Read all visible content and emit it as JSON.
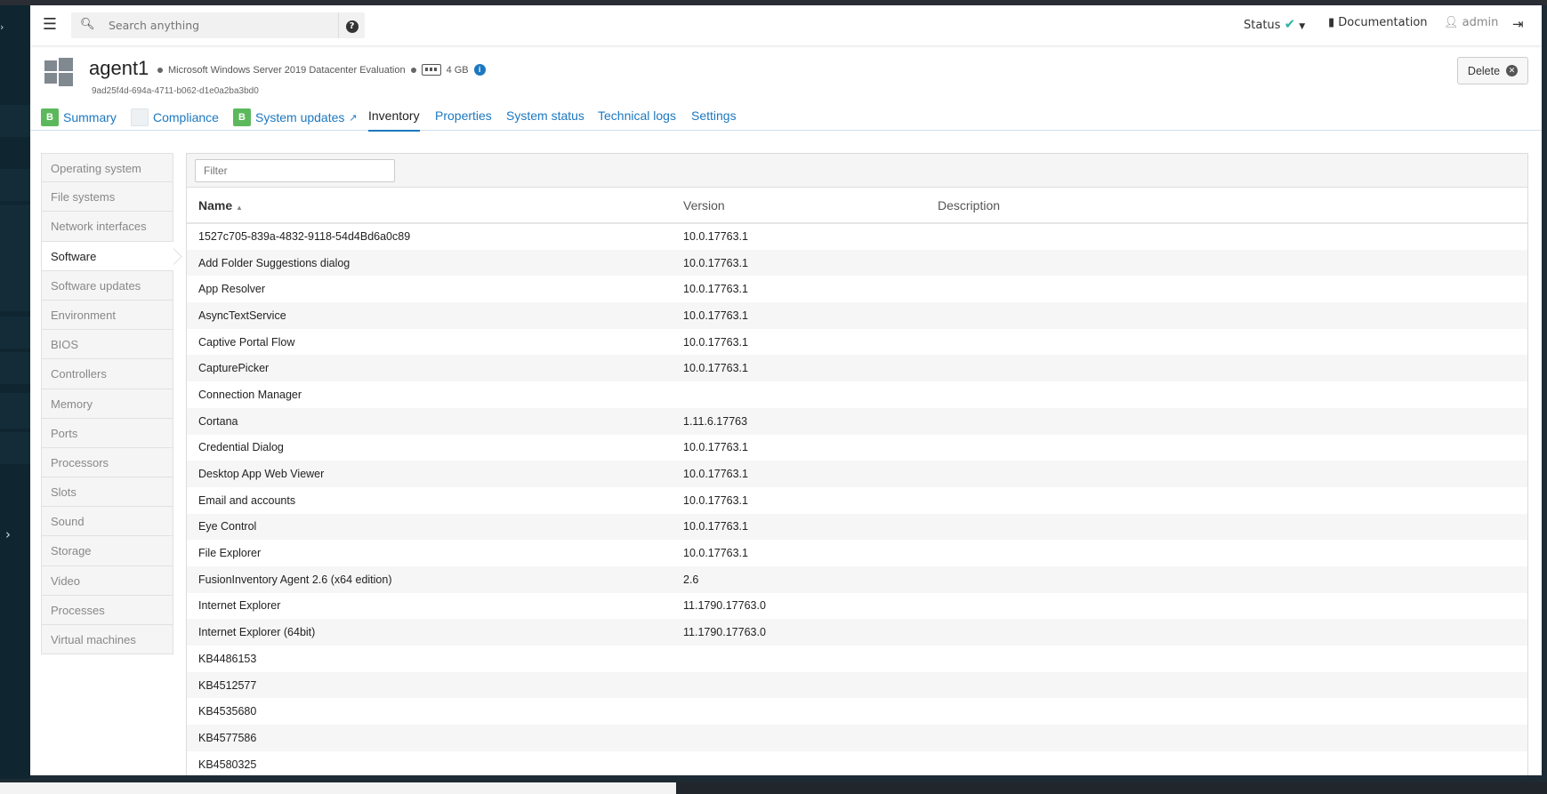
{
  "header": {
    "search_placeholder": "Search anything",
    "status_label": "Status",
    "documentation_label": "Documentation",
    "user_label": "admin"
  },
  "agent": {
    "name": "agent1",
    "os": "Microsoft Windows Server 2019 Datacenter Evaluation",
    "memory": "4 GB",
    "uuid": "9ad25f4d-694a-4711-b062-d1e0a2ba3bd0",
    "delete_label": "Delete"
  },
  "tabs": [
    {
      "label": "Summary",
      "badge": "B"
    },
    {
      "label": "Compliance"
    },
    {
      "label": "System updates",
      "badge": "B"
    },
    {
      "label": "Inventory"
    },
    {
      "label": "Properties"
    },
    {
      "label": "System status"
    },
    {
      "label": "Technical logs"
    },
    {
      "label": "Settings"
    }
  ],
  "sidebar": {
    "items": [
      "Operating system",
      "File systems",
      "Network interfaces",
      "Software",
      "Software updates",
      "Environment",
      "BIOS",
      "Controllers",
      "Memory",
      "Ports",
      "Processors",
      "Slots",
      "Sound",
      "Storage",
      "Video",
      "Processes",
      "Virtual machines"
    ],
    "active": "Software"
  },
  "table": {
    "filter_placeholder": "Filter",
    "columns": [
      "Name",
      "Version",
      "Description"
    ],
    "rows": [
      [
        "1527c705-839a-4832-9118-54d4Bd6a0c89",
        "10.0.17763.1",
        ""
      ],
      [
        "Add Folder Suggestions dialog",
        "10.0.17763.1",
        ""
      ],
      [
        "App Resolver",
        "10.0.17763.1",
        ""
      ],
      [
        "AsyncTextService",
        "10.0.17763.1",
        ""
      ],
      [
        "Captive Portal Flow",
        "10.0.17763.1",
        ""
      ],
      [
        "CapturePicker",
        "10.0.17763.1",
        ""
      ],
      [
        "Connection Manager",
        "",
        ""
      ],
      [
        "Cortana",
        "1.11.6.17763",
        ""
      ],
      [
        "Credential Dialog",
        "10.0.17763.1",
        ""
      ],
      [
        "Desktop App Web Viewer",
        "10.0.17763.1",
        ""
      ],
      [
        "Email and accounts",
        "10.0.17763.1",
        ""
      ],
      [
        "Eye Control",
        "10.0.17763.1",
        ""
      ],
      [
        "File Explorer",
        "10.0.17763.1",
        ""
      ],
      [
        "FusionInventory Agent 2.6 (x64 edition)",
        "2.6",
        ""
      ],
      [
        "Internet Explorer",
        "11.1790.17763.0",
        ""
      ],
      [
        "Internet Explorer (64bit)",
        "11.1790.17763.0",
        ""
      ],
      [
        "KB4486153",
        "",
        ""
      ],
      [
        "KB4512577",
        "",
        ""
      ],
      [
        "KB4535680",
        "",
        ""
      ],
      [
        "KB4577586",
        "",
        ""
      ],
      [
        "KB4580325",
        "",
        ""
      ]
    ]
  }
}
